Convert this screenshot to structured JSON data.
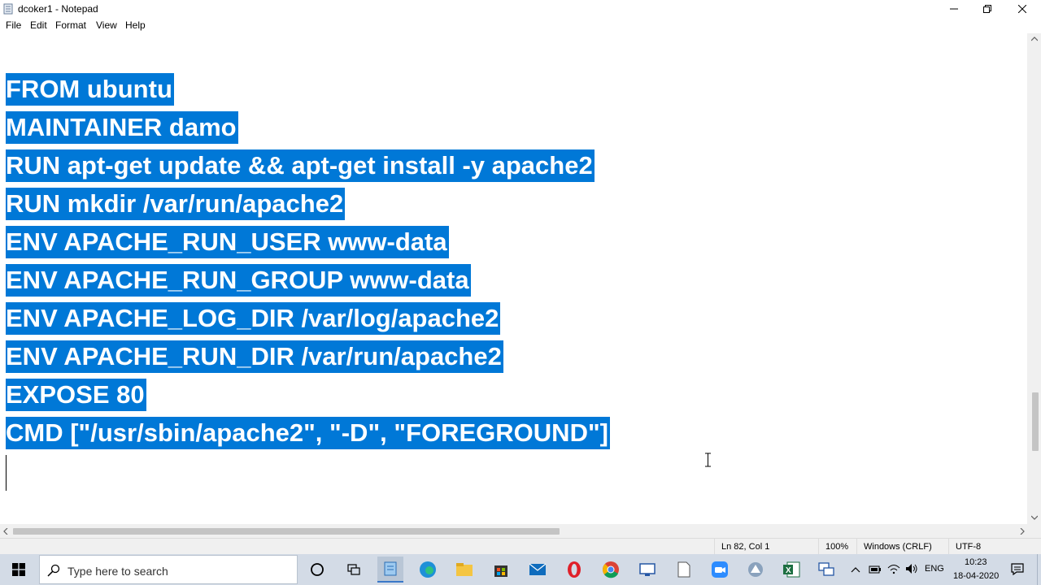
{
  "window": {
    "title": "dcoker1 - Notepad"
  },
  "menu": {
    "items": [
      "File",
      "Edit",
      "Format",
      "View",
      "Help"
    ]
  },
  "editor": {
    "lines": [
      "FROM ubuntu",
      "MAINTAINER damo",
      "RUN apt-get update && apt-get install -y apache2",
      "RUN mkdir /var/run/apache2",
      "ENV APACHE_RUN_USER www-data",
      "ENV APACHE_RUN_GROUP www-data",
      "ENV APACHE_LOG_DIR /var/log/apache2",
      "ENV APACHE_RUN_DIR /var/run/apache2",
      "EXPOSE 80",
      "CMD [\"/usr/sbin/apache2\", \"-D\", \"FOREGROUND\"]"
    ],
    "selection_color": "#0078d7"
  },
  "status": {
    "position": "Ln 82, Col 1",
    "zoom": "100%",
    "line_ending": "Windows (CRLF)",
    "encoding": "UTF-8"
  },
  "taskbar": {
    "search_placeholder": "Type here to search",
    "apps": [
      "cortana-icon",
      "task-view-icon",
      "notepad-app-icon",
      "edge-icon",
      "file-explorer-icon",
      "store-icon",
      "mail-icon",
      "opera-icon",
      "chrome-icon",
      "remote-desktop-icon",
      "file-icon",
      "zoom-icon",
      "app-icon",
      "excel-icon",
      "network-app-icon"
    ],
    "tray": {
      "language": "ENG",
      "time": "10:23",
      "date": "18-04-2020"
    }
  }
}
